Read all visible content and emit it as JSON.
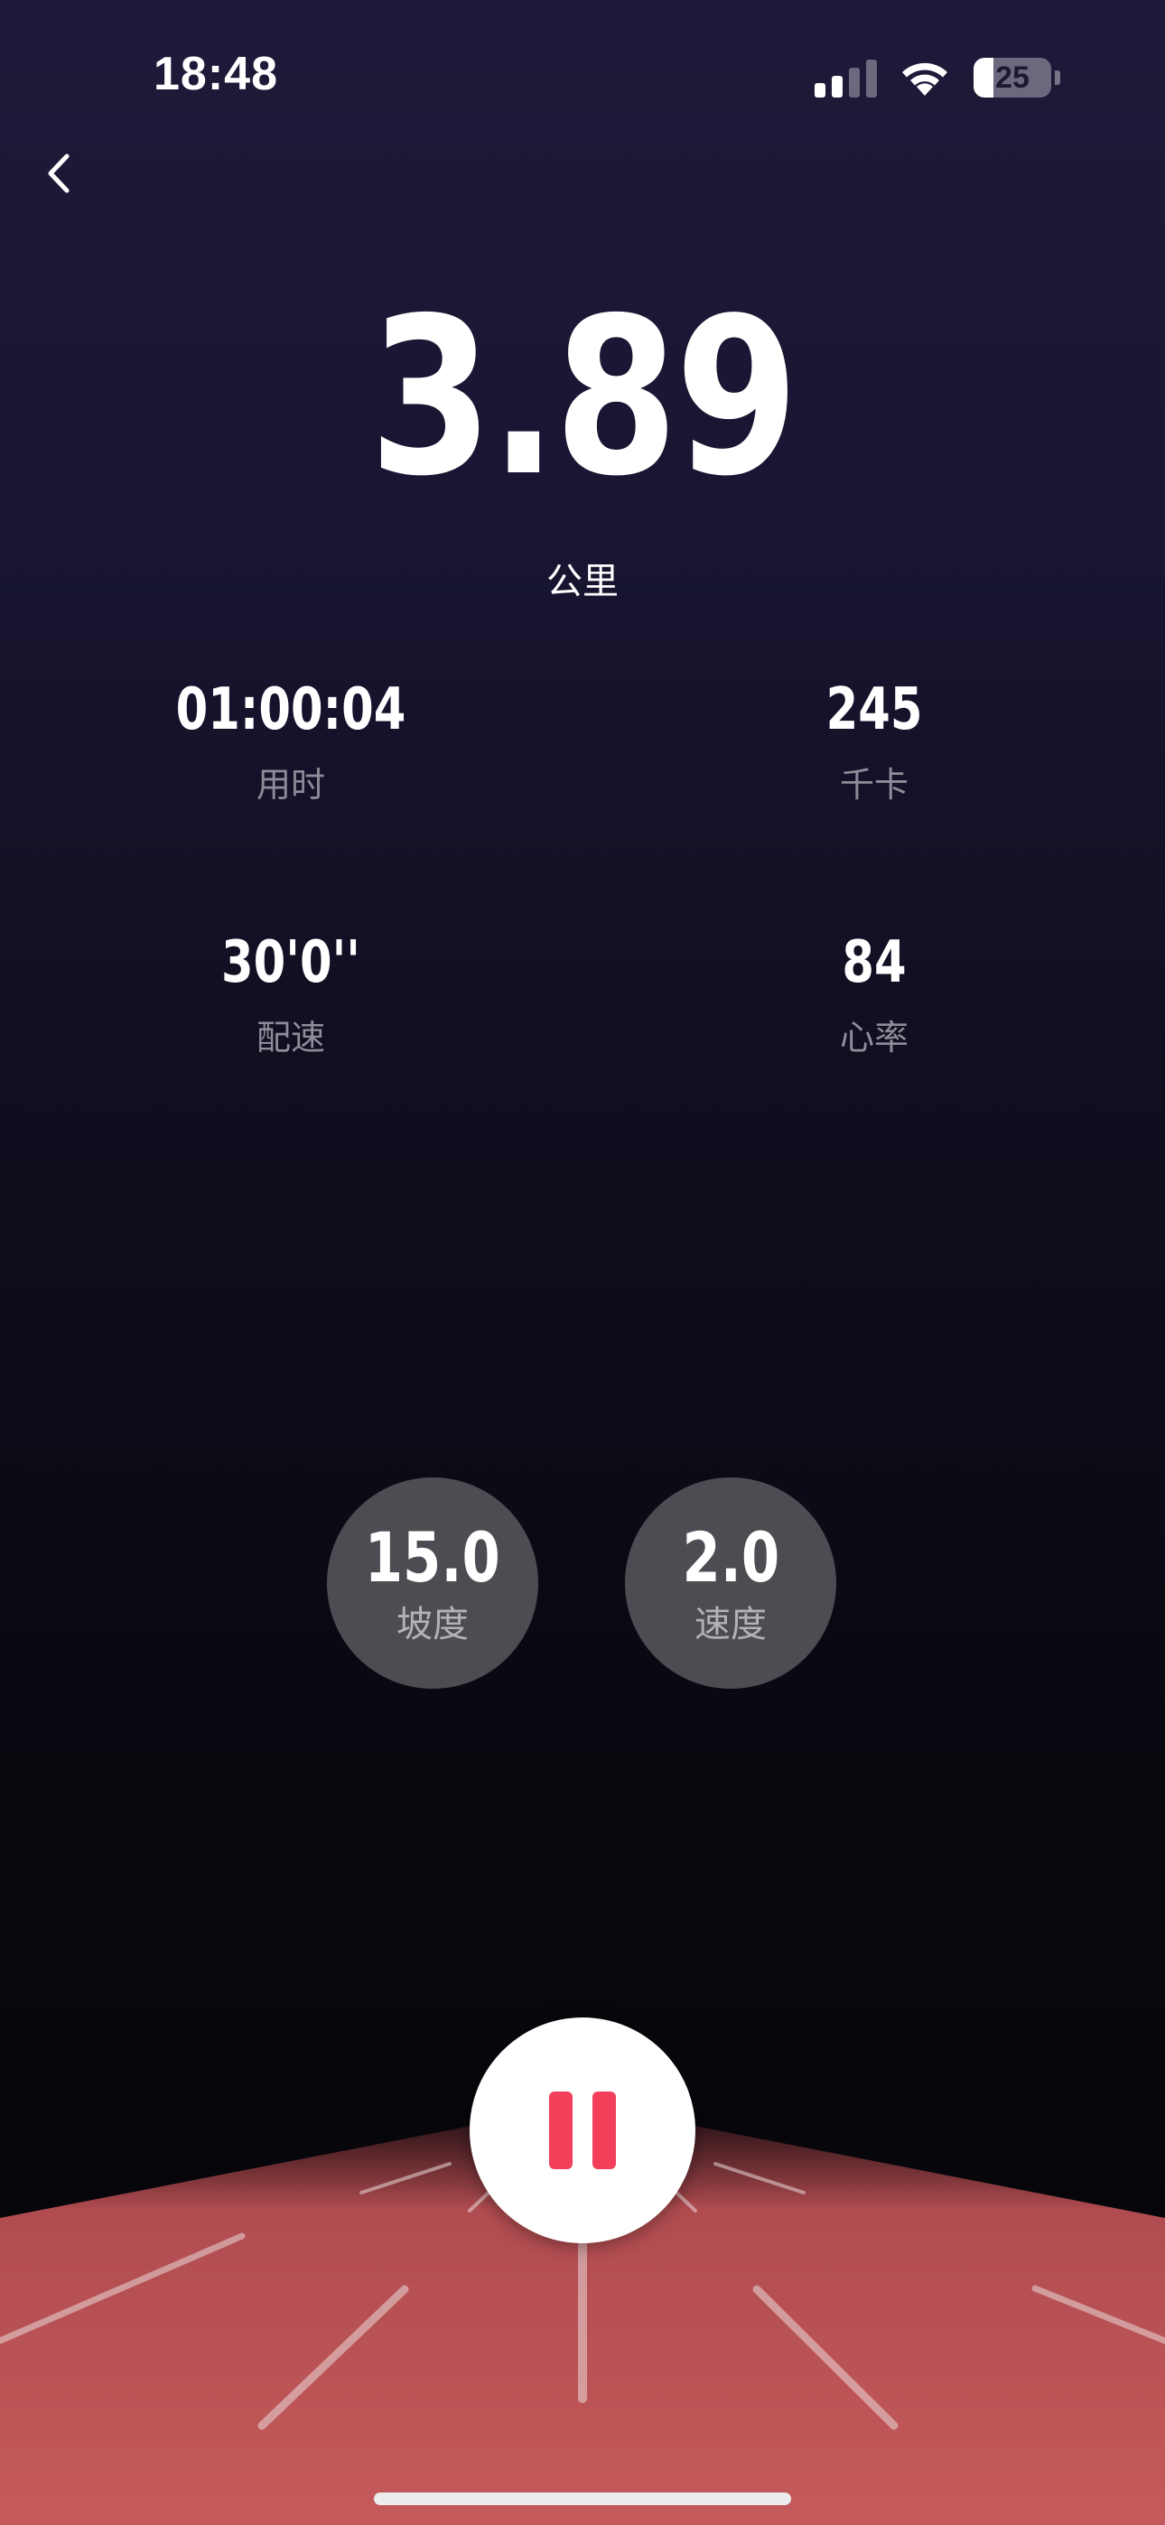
{
  "status_bar": {
    "time": "18:48",
    "battery_level": "25",
    "battery_fraction": 0.25,
    "signal_bars_active": 2,
    "signal_bars_total": 4,
    "icons": [
      "signal-icon",
      "wifi-icon",
      "battery-icon"
    ]
  },
  "nav": {
    "back_icon": "chevron-left-icon"
  },
  "distance": {
    "value": "3.89",
    "unit": "公里"
  },
  "stats": {
    "duration": {
      "value": "01:00:04",
      "label": "用时"
    },
    "calories": {
      "value": "245",
      "label": "千卡"
    },
    "pace": {
      "value": "30'0''",
      "label": "配速"
    },
    "heart_rate": {
      "value": "84",
      "label": "心率"
    }
  },
  "controls": {
    "incline": {
      "value": "15.0",
      "label": "坡度"
    },
    "speed": {
      "value": "2.0",
      "label": "速度"
    }
  },
  "actions": {
    "pause_icon": "pause-icon",
    "pause_color": "#f2405a"
  },
  "theme": {
    "track_color": "#c25556",
    "control_bg": "#4d4c52",
    "label_color": "#8d8c99"
  }
}
